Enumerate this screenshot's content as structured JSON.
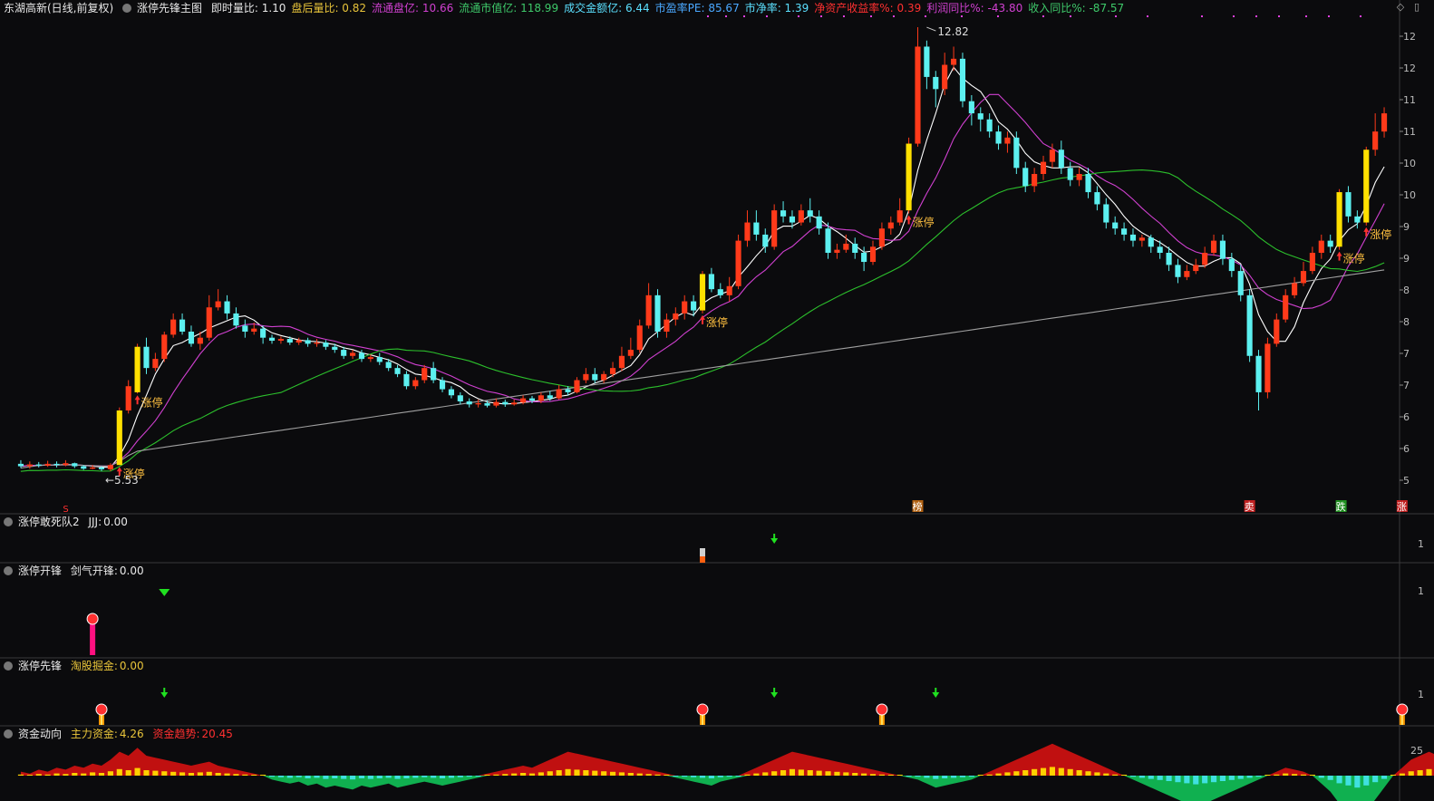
{
  "header": {
    "stock": "东湖高新(日线,前复权)",
    "indicator": "涨停先锋主图",
    "items": [
      {
        "label": "即时量比:",
        "value": "1.10",
        "color": "#e8e8e8"
      },
      {
        "label": "盘后量比:",
        "value": "0.82",
        "color": "#e8c43a"
      },
      {
        "label": "流通盘亿:",
        "value": "10.66",
        "color": "#d040d0"
      },
      {
        "label": "流通市值亿:",
        "value": "118.99",
        "color": "#3ec96a"
      },
      {
        "label": "成交金额亿:",
        "value": "6.44",
        "color": "#5be0ff"
      },
      {
        "label": "市盈率PE:",
        "value": "85.67",
        "color": "#4aa8ff"
      },
      {
        "label": "市净率:",
        "value": "1.39",
        "color": "#5be0ff"
      },
      {
        "label": "净资产收益率%:",
        "value": "0.39",
        "color": "#ff3030"
      },
      {
        "label": "利润同比%:",
        "value": "-43.80",
        "color": "#d040d0"
      },
      {
        "label": "收入同比%:",
        "value": "-87.57",
        "color": "#3ec96a"
      }
    ]
  },
  "main_labels": {
    "high": "12.82",
    "low": "5.53",
    "limit_up": "涨停",
    "marker_bang": "榜",
    "marker_sell": "卖",
    "marker_zhang": "涨",
    "marker_die": "跌",
    "marker_s": "S"
  },
  "y_axis": [
    "12",
    "12",
    "11",
    "11",
    "10",
    "10",
    "9",
    "9",
    "8",
    "8",
    "7",
    "7",
    "6",
    "6",
    "5"
  ],
  "panels": [
    {
      "name": "涨停敢死队2",
      "label": "JJJ:",
      "value": "0.00",
      "axis": "1"
    },
    {
      "name": "涨停开锋",
      "label": "剑气开锋:",
      "value": "0.00",
      "axis": "1"
    },
    {
      "name": "涨停先锋",
      "label": "淘股掘金:",
      "value": "0.00",
      "axis": "1"
    },
    {
      "name": "资金动向",
      "label": "主力资金:",
      "value": "4.26",
      "label2": "资金趋势:",
      "value2": "20.45",
      "axis": "25"
    }
  ],
  "colors": {
    "up": "#ff3a1a",
    "down": "#5cf0f0",
    "limit": "#ffe000",
    "ma5": "#ffffff",
    "ma10": "#d040d0",
    "ma30": "#2cc02c",
    "ma60": "#a0a0a0"
  },
  "chart_data": {
    "type": "candlestick",
    "ylim": [
      5.2,
      13.0
    ],
    "candles": [
      [
        5.62,
        5.58,
        5.68,
        5.55,
        0
      ],
      [
        5.58,
        5.61,
        5.66,
        5.54,
        0
      ],
      [
        5.61,
        5.59,
        5.65,
        5.56,
        0
      ],
      [
        5.59,
        5.62,
        5.67,
        5.57,
        0
      ],
      [
        5.62,
        5.6,
        5.66,
        5.56,
        0
      ],
      [
        5.6,
        5.63,
        5.68,
        5.58,
        0
      ],
      [
        5.63,
        5.58,
        5.64,
        5.55,
        0
      ],
      [
        5.58,
        5.54,
        5.6,
        5.52,
        0
      ],
      [
        5.54,
        5.56,
        5.6,
        5.53,
        0
      ],
      [
        5.56,
        5.53,
        5.58,
        5.5,
        0
      ],
      [
        5.53,
        5.6,
        5.63,
        5.5,
        0
      ],
      [
        5.6,
        6.5,
        6.55,
        5.6,
        1
      ],
      [
        6.5,
        6.9,
        7.0,
        6.45,
        0
      ],
      [
        6.8,
        7.55,
        7.6,
        6.78,
        1
      ],
      [
        7.55,
        7.2,
        7.7,
        7.1,
        0
      ],
      [
        7.2,
        7.35,
        7.45,
        7.15,
        0
      ],
      [
        7.35,
        7.75,
        7.8,
        7.3,
        0
      ],
      [
        7.75,
        8.0,
        8.1,
        7.7,
        0
      ],
      [
        8.0,
        7.8,
        8.1,
        7.75,
        0
      ],
      [
        7.8,
        7.6,
        7.9,
        7.55,
        0
      ],
      [
        7.6,
        7.7,
        7.8,
        7.5,
        0
      ],
      [
        7.7,
        8.2,
        8.4,
        7.65,
        0
      ],
      [
        8.2,
        8.3,
        8.5,
        8.15,
        0
      ],
      [
        8.3,
        8.1,
        8.4,
        8.0,
        0
      ],
      [
        8.1,
        7.9,
        8.2,
        7.85,
        0
      ],
      [
        7.9,
        7.8,
        8.0,
        7.7,
        0
      ],
      [
        7.8,
        7.85,
        7.95,
        7.75,
        0
      ],
      [
        7.85,
        7.7,
        7.9,
        7.6,
        0
      ],
      [
        7.7,
        7.65,
        7.75,
        7.6,
        0
      ],
      [
        7.65,
        7.68,
        7.72,
        7.6,
        0
      ],
      [
        7.68,
        7.62,
        7.72,
        7.58,
        0
      ],
      [
        7.62,
        7.66,
        7.7,
        7.58,
        0
      ],
      [
        7.66,
        7.6,
        7.7,
        7.55,
        0
      ],
      [
        7.6,
        7.62,
        7.68,
        7.55,
        0
      ],
      [
        7.62,
        7.55,
        7.66,
        7.5,
        0
      ],
      [
        7.55,
        7.5,
        7.6,
        7.45,
        0
      ],
      [
        7.5,
        7.4,
        7.55,
        7.35,
        0
      ],
      [
        7.4,
        7.45,
        7.5,
        7.35,
        0
      ],
      [
        7.45,
        7.35,
        7.5,
        7.3,
        0
      ],
      [
        7.35,
        7.38,
        7.42,
        7.3,
        0
      ],
      [
        7.38,
        7.3,
        7.45,
        7.25,
        0
      ],
      [
        7.3,
        7.2,
        7.35,
        7.15,
        0
      ],
      [
        7.2,
        7.1,
        7.25,
        7.05,
        0
      ],
      [
        7.1,
        6.9,
        7.15,
        6.85,
        0
      ],
      [
        6.9,
        7.0,
        7.05,
        6.85,
        0
      ],
      [
        7.0,
        7.2,
        7.25,
        6.95,
        0
      ],
      [
        7.2,
        7.0,
        7.3,
        6.95,
        0
      ],
      [
        7.0,
        6.85,
        7.05,
        6.8,
        0
      ],
      [
        6.85,
        6.75,
        6.9,
        6.7,
        0
      ],
      [
        6.75,
        6.65,
        6.8,
        6.6,
        0
      ],
      [
        6.65,
        6.6,
        6.7,
        6.55,
        0
      ],
      [
        6.6,
        6.62,
        6.68,
        6.55,
        0
      ],
      [
        6.62,
        6.58,
        6.66,
        6.55,
        0
      ],
      [
        6.58,
        6.64,
        6.7,
        6.55,
        0
      ],
      [
        6.64,
        6.6,
        6.68,
        6.56,
        0
      ],
      [
        6.6,
        6.63,
        6.68,
        6.58,
        0
      ],
      [
        6.63,
        6.7,
        6.75,
        6.6,
        0
      ],
      [
        6.7,
        6.66,
        6.74,
        6.62,
        0
      ],
      [
        6.66,
        6.75,
        6.8,
        6.62,
        0
      ],
      [
        6.75,
        6.7,
        6.82,
        6.66,
        0
      ],
      [
        6.7,
        6.85,
        6.92,
        6.68,
        0
      ],
      [
        6.85,
        6.8,
        6.9,
        6.75,
        0
      ],
      [
        6.8,
        7.0,
        7.05,
        6.78,
        0
      ],
      [
        7.0,
        7.1,
        7.2,
        6.95,
        0
      ],
      [
        7.1,
        7.0,
        7.2,
        6.95,
        0
      ],
      [
        7.0,
        7.1,
        7.15,
        6.95,
        0
      ],
      [
        7.1,
        7.2,
        7.3,
        7.05,
        0
      ],
      [
        7.2,
        7.4,
        7.55,
        7.15,
        0
      ],
      [
        7.4,
        7.5,
        7.7,
        7.35,
        0
      ],
      [
        7.5,
        7.9,
        8.0,
        7.45,
        0
      ],
      [
        7.9,
        8.4,
        8.6,
        7.85,
        0
      ],
      [
        8.4,
        7.8,
        8.5,
        7.7,
        0
      ],
      [
        7.8,
        8.0,
        8.1,
        7.7,
        0
      ],
      [
        8.0,
        8.1,
        8.2,
        7.9,
        0
      ],
      [
        8.1,
        8.3,
        8.4,
        8.0,
        0
      ],
      [
        8.3,
        8.15,
        8.4,
        8.05,
        0
      ],
      [
        8.15,
        8.75,
        8.8,
        8.1,
        1
      ],
      [
        8.75,
        8.5,
        8.85,
        8.45,
        0
      ],
      [
        8.5,
        8.4,
        8.6,
        8.35,
        0
      ],
      [
        8.4,
        8.55,
        8.7,
        8.3,
        0
      ],
      [
        8.55,
        9.3,
        9.4,
        8.5,
        0
      ],
      [
        9.3,
        9.6,
        9.8,
        9.2,
        0
      ],
      [
        9.6,
        9.4,
        9.8,
        9.3,
        0
      ],
      [
        9.4,
        9.2,
        9.5,
        9.1,
        0
      ],
      [
        9.2,
        9.8,
        9.9,
        9.15,
        0
      ],
      [
        9.8,
        9.7,
        9.95,
        9.6,
        0
      ],
      [
        9.7,
        9.6,
        9.8,
        9.5,
        0
      ],
      [
        9.6,
        9.8,
        9.9,
        9.55,
        0
      ],
      [
        9.8,
        9.7,
        10.0,
        9.6,
        0
      ],
      [
        9.7,
        9.5,
        9.8,
        9.4,
        0
      ],
      [
        9.5,
        9.1,
        9.6,
        9.0,
        0
      ],
      [
        9.1,
        9.15,
        9.25,
        9.0,
        0
      ],
      [
        9.15,
        9.25,
        9.4,
        9.1,
        0
      ],
      [
        9.25,
        9.1,
        9.35,
        9.0,
        0
      ],
      [
        9.1,
        8.95,
        9.2,
        8.8,
        0
      ],
      [
        8.95,
        9.2,
        9.3,
        8.9,
        0
      ],
      [
        9.2,
        9.5,
        9.6,
        9.15,
        0
      ],
      [
        9.5,
        9.6,
        9.7,
        9.4,
        0
      ],
      [
        9.6,
        9.8,
        10.0,
        9.55,
        0
      ],
      [
        9.8,
        10.9,
        11.0,
        9.75,
        1
      ],
      [
        10.9,
        12.5,
        12.82,
        10.85,
        0
      ],
      [
        12.5,
        12.0,
        12.6,
        11.8,
        0
      ],
      [
        12.0,
        11.8,
        12.1,
        11.5,
        0
      ],
      [
        11.8,
        12.2,
        12.4,
        11.7,
        0
      ],
      [
        12.2,
        12.3,
        12.5,
        12.1,
        0
      ],
      [
        12.3,
        11.6,
        12.4,
        11.5,
        0
      ],
      [
        11.6,
        11.4,
        11.7,
        11.2,
        0
      ],
      [
        11.4,
        11.3,
        11.5,
        11.1,
        0
      ],
      [
        11.3,
        11.1,
        11.4,
        11.0,
        0
      ],
      [
        11.1,
        10.9,
        11.2,
        10.8,
        0
      ],
      [
        10.9,
        11.0,
        11.1,
        10.75,
        0
      ],
      [
        11.0,
        10.5,
        11.1,
        10.4,
        0
      ],
      [
        10.5,
        10.2,
        10.6,
        10.1,
        0
      ],
      [
        10.2,
        10.4,
        10.5,
        10.1,
        0
      ],
      [
        10.4,
        10.6,
        10.7,
        10.3,
        0
      ],
      [
        10.6,
        10.8,
        10.9,
        10.5,
        0
      ],
      [
        10.8,
        10.5,
        10.95,
        10.4,
        0
      ],
      [
        10.5,
        10.3,
        10.6,
        10.2,
        0
      ],
      [
        10.3,
        10.4,
        10.5,
        10.2,
        0
      ],
      [
        10.4,
        10.1,
        10.5,
        10.0,
        0
      ],
      [
        10.1,
        9.9,
        10.2,
        9.8,
        0
      ],
      [
        9.9,
        9.6,
        10.0,
        9.5,
        0
      ],
      [
        9.6,
        9.5,
        9.7,
        9.4,
        0
      ],
      [
        9.5,
        9.4,
        9.6,
        9.3,
        0
      ],
      [
        9.4,
        9.3,
        9.5,
        9.2,
        0
      ],
      [
        9.3,
        9.35,
        9.4,
        9.2,
        0
      ],
      [
        9.35,
        9.2,
        9.4,
        9.1,
        0
      ],
      [
        9.2,
        9.1,
        9.3,
        9.0,
        0
      ],
      [
        9.1,
        8.9,
        9.2,
        8.8,
        0
      ],
      [
        8.9,
        8.7,
        9.0,
        8.6,
        0
      ],
      [
        8.7,
        8.8,
        8.9,
        8.65,
        0
      ],
      [
        8.8,
        8.9,
        9.0,
        8.75,
        0
      ],
      [
        8.9,
        9.1,
        9.2,
        8.85,
        0
      ],
      [
        9.1,
        9.3,
        9.4,
        9.05,
        0
      ],
      [
        9.3,
        9.0,
        9.4,
        8.9,
        0
      ],
      [
        9.0,
        8.8,
        9.1,
        8.7,
        0
      ],
      [
        8.8,
        8.4,
        8.9,
        8.3,
        0
      ],
      [
        8.4,
        7.4,
        8.5,
        7.3,
        0
      ],
      [
        7.4,
        6.8,
        7.5,
        6.5,
        0
      ],
      [
        6.8,
        7.6,
        7.7,
        6.7,
        0
      ],
      [
        7.6,
        8.0,
        8.1,
        7.55,
        0
      ],
      [
        8.0,
        8.4,
        8.5,
        7.95,
        0
      ],
      [
        8.4,
        8.6,
        8.7,
        8.35,
        0
      ],
      [
        8.6,
        8.8,
        8.95,
        8.55,
        0
      ],
      [
        8.8,
        9.1,
        9.2,
        8.75,
        0
      ],
      [
        9.1,
        9.3,
        9.4,
        9.0,
        0
      ],
      [
        9.3,
        9.2,
        9.4,
        9.1,
        0
      ],
      [
        9.2,
        10.1,
        10.15,
        9.15,
        1
      ],
      [
        10.1,
        9.7,
        10.2,
        9.6,
        0
      ],
      [
        9.7,
        9.6,
        9.8,
        9.5,
        0
      ],
      [
        9.6,
        10.8,
        10.85,
        9.55,
        1
      ],
      [
        10.8,
        11.1,
        11.4,
        10.7,
        0
      ],
      [
        11.1,
        11.4,
        11.5,
        11.0,
        0
      ]
    ],
    "ma_periods": [
      5,
      10,
      30,
      60
    ],
    "flow": [
      2,
      1,
      3,
      2,
      4,
      3,
      5,
      4,
      6,
      5,
      8,
      12,
      10,
      14,
      10,
      9,
      8,
      7,
      6,
      5,
      6,
      7,
      5,
      4,
      3,
      2,
      1,
      0,
      -2,
      -3,
      -4,
      -3,
      -5,
      -4,
      -6,
      -5,
      -6,
      -7,
      -5,
      -6,
      -5,
      -4,
      -6,
      -5,
      -4,
      -3,
      -4,
      -5,
      -4,
      -3,
      -2,
      -1,
      1,
      2,
      3,
      4,
      5,
      4,
      6,
      8,
      10,
      12,
      11,
      10,
      9,
      8,
      7,
      6,
      5,
      4,
      3,
      2,
      1,
      -1,
      -2,
      -3,
      -4,
      -5,
      -3,
      -2,
      -1,
      2,
      4,
      6,
      8,
      10,
      12,
      11,
      10,
      9,
      8,
      7,
      6,
      5,
      4,
      3,
      2,
      1,
      0,
      -1,
      -2,
      -4,
      -6,
      -5,
      -4,
      -3,
      -2,
      0,
      2,
      4,
      6,
      8,
      10,
      12,
      14,
      16,
      14,
      12,
      10,
      8,
      6,
      4,
      2,
      0,
      -2,
      -4,
      -6,
      -8,
      -10,
      -12,
      -14,
      -16,
      -14,
      -12,
      -10,
      -8,
      -6,
      -4,
      -2,
      0,
      2,
      4,
      3,
      2,
      0,
      -4,
      -8,
      -14,
      -18,
      -22,
      -18,
      -12,
      -6,
      0,
      4,
      8,
      10,
      12,
      10,
      12,
      14,
      16,
      18
    ]
  }
}
